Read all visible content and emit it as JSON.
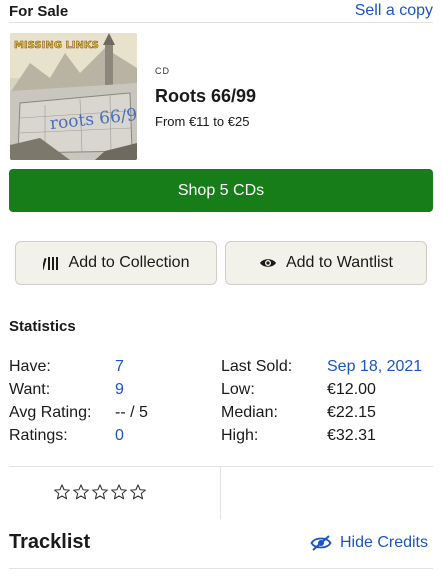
{
  "for_sale": {
    "title": "For Sale",
    "sell_link": "Sell a copy"
  },
  "listing": {
    "cover_band_text": "MISSING LINKS",
    "cover_title_text": "roots 66/99",
    "format": "CD",
    "title": "Roots 66/99",
    "price_range": "From €11 to €25"
  },
  "shop_button": {
    "label": "Shop 5 CDs"
  },
  "actions": {
    "collection_label": "Add to Collection",
    "collection_icon": "collection-bars-icon",
    "wantlist_label": "Add to Wantlist",
    "wantlist_icon": "eye-icon"
  },
  "statistics": {
    "title": "Statistics",
    "have": {
      "label": "Have:",
      "value": "7"
    },
    "want": {
      "label": "Want:",
      "value": "9"
    },
    "avg_rating": {
      "label": "Avg Rating:",
      "value": "-- / 5"
    },
    "ratings": {
      "label": "Ratings:",
      "value": "0"
    },
    "last_sold": {
      "label": "Last Sold:",
      "value": "Sep 18, 2021"
    },
    "low": {
      "label": "Low:",
      "value": "€12.00"
    },
    "median": {
      "label": "Median:",
      "value": "€22.15"
    },
    "high": {
      "label": "High:",
      "value": "€32.31"
    }
  },
  "user_rating": {
    "stars": 5,
    "icon": "star-outline-icon"
  },
  "tracklist": {
    "title": "Tracklist",
    "hide_credits": "Hide Credits",
    "hide_credits_icon": "eye-slash-icon"
  },
  "colors": {
    "link": "#1b55c2",
    "shop_button": "#167d19",
    "action_button_bg": "#f3f2ea"
  }
}
